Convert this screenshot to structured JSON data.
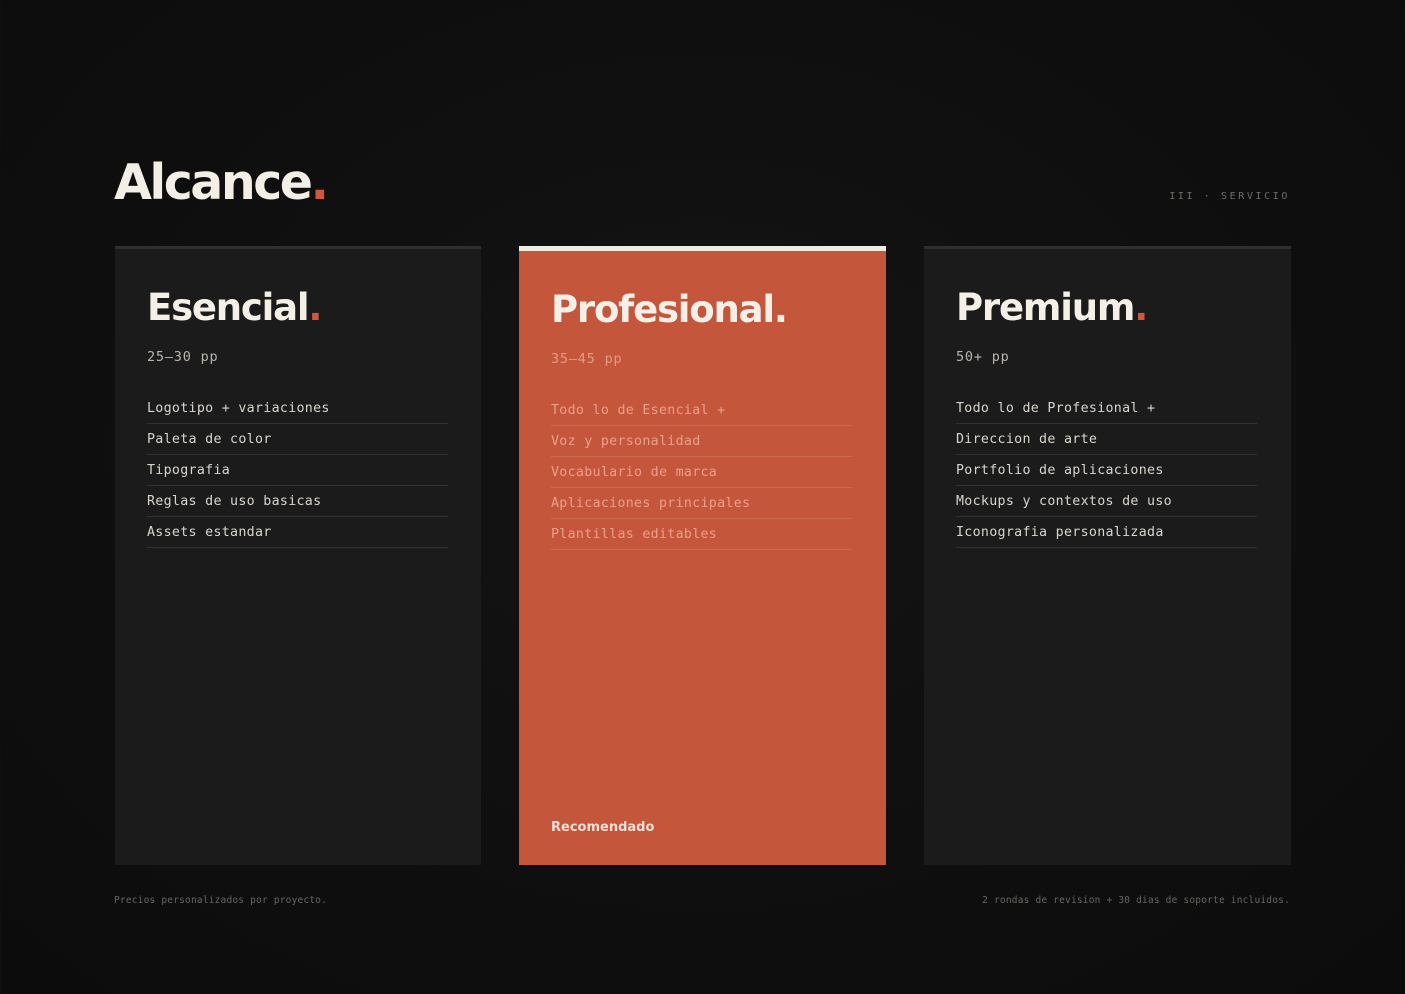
{
  "header": {
    "title": "Alcance",
    "title_dot": ".",
    "section_tag": "III · SERVICIO"
  },
  "plans": [
    {
      "name": "Esencial",
      "dot": ".",
      "pages": "25–30 pp",
      "features": [
        "Logotipo + variaciones",
        "Paleta de color",
        "Tipografia",
        "Reglas de uso basicas",
        "Assets estandar"
      ]
    },
    {
      "name": "Profesional",
      "dot": ".",
      "pages": "35–45 pp",
      "features": [
        "Todo lo de Esencial +",
        "Voz y personalidad",
        "Vocabulario de marca",
        "Aplicaciones principales",
        "Plantillas editables"
      ],
      "badge": "Recomendado",
      "highlighted": true
    },
    {
      "name": "Premium",
      "dot": ".",
      "pages": "50+ pp",
      "features": [
        "Todo lo de Profesional +",
        "Direccion de arte",
        "Portfolio de aplicaciones",
        "Mockups y contextos de uso",
        "Iconografia personalizada"
      ]
    }
  ],
  "footer": {
    "left": "Precios personalizados por proyecto.",
    "right": "2 rondas de revision + 30 dias de soporte incluidos."
  },
  "colors": {
    "background": "#0f0f0f",
    "card": "#1b1b1b",
    "accent": "#c4563c",
    "dot": "#d0573c",
    "text": "#f3efe6"
  }
}
